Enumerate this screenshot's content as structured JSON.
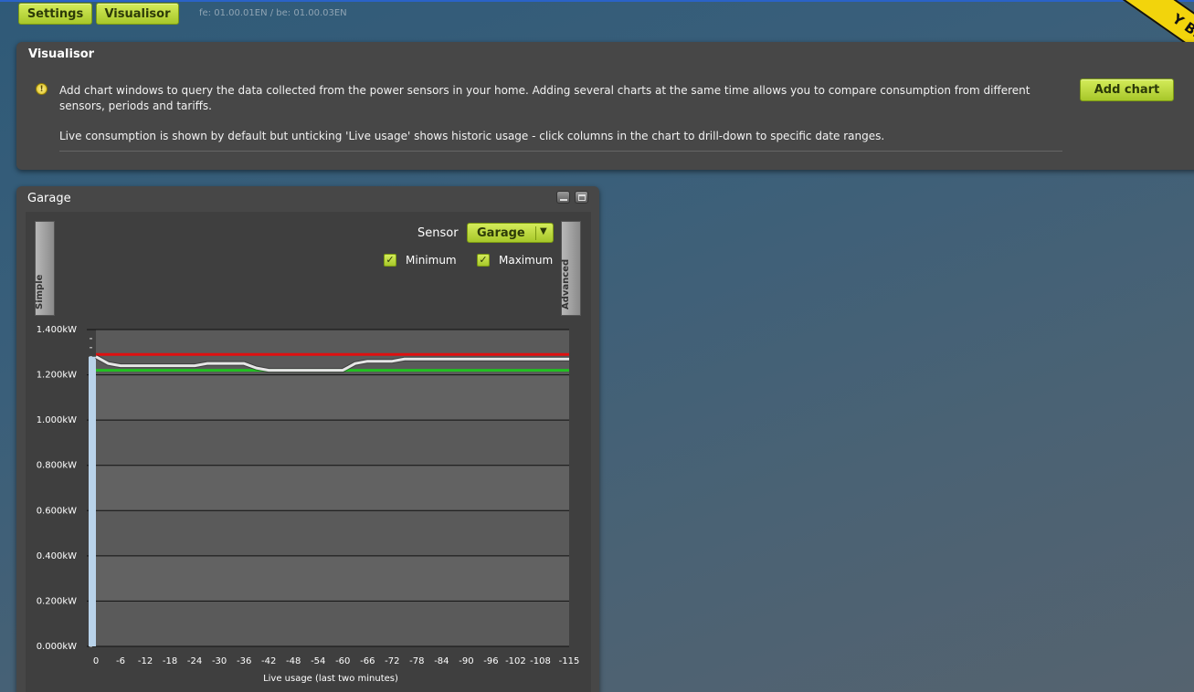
{
  "topbar": {
    "settings_label": "Settings",
    "visualisor_label": "Visualisor",
    "version": "fe: 01.00.01EN / be: 01.00.03EN",
    "ribbon_text": "Y BILL"
  },
  "panel": {
    "title": "Visualisor",
    "info_icon": "info-icon",
    "text1": "Add chart windows to query the data collected from the power sensors in your home. Adding several charts at the same time allows you to compare consumption from different sensors, periods and tariffs.",
    "text2": "Live consumption is shown by default but unticking 'Live usage' shows historic usage - click columns in the chart to drill-down to specific date ranges.",
    "add_chart_label": "Add chart"
  },
  "chart_window": {
    "title": "Garage",
    "minimize_icon": "minimize-icon",
    "maximize_icon": "maximize-icon",
    "simple_tab": "Simple",
    "advanced_tab": "Advanced",
    "sensor_label": "Sensor",
    "sensor_value": "Garage",
    "minimum_label": "Minimum",
    "maximum_label": "Maximum",
    "minimum_checked": true,
    "maximum_checked": true,
    "colors": {
      "accent": "#b8d63a",
      "max_line": "#e01010",
      "min_line": "#22c022",
      "live_line": "#e6e6e6",
      "live_bar": "#b9d3ea"
    }
  },
  "chart_data": {
    "type": "line",
    "xlabel": "Live usage (last two minutes)",
    "ylabel": "",
    "x_ticks": [
      "0",
      "-6",
      "-12",
      "-18",
      "-24",
      "-30",
      "-36",
      "-42",
      "-48",
      "-54",
      "-60",
      "-66",
      "-72",
      "-78",
      "-84",
      "-90",
      "-96",
      "-102",
      "-108",
      "-115"
    ],
    "y_ticks": [
      "0.000kW",
      "0.200kW",
      "0.400kW",
      "0.600kW",
      "0.800kW",
      "1.000kW",
      "1.200kW",
      "1.400kW"
    ],
    "ylim": [
      0,
      1.4
    ],
    "xlim": [
      0,
      -115
    ],
    "grid": true,
    "maximum": 1.29,
    "minimum": 1.22,
    "series": [
      {
        "x": [
          0,
          -3,
          -6,
          -12,
          -18,
          -24,
          -27,
          -30,
          -36,
          -39,
          -42,
          -48,
          -54,
          -60,
          -63,
          -66,
          -72,
          -75,
          -78,
          -84,
          -90,
          -96,
          -102,
          -108,
          -115
        ],
        "values": [
          1.28,
          1.25,
          1.24,
          1.24,
          1.24,
          1.24,
          1.25,
          1.25,
          1.25,
          1.23,
          1.22,
          1.22,
          1.22,
          1.22,
          1.25,
          1.26,
          1.26,
          1.27,
          1.27,
          1.27,
          1.27,
          1.27,
          1.27,
          1.27,
          1.27
        ]
      }
    ]
  }
}
